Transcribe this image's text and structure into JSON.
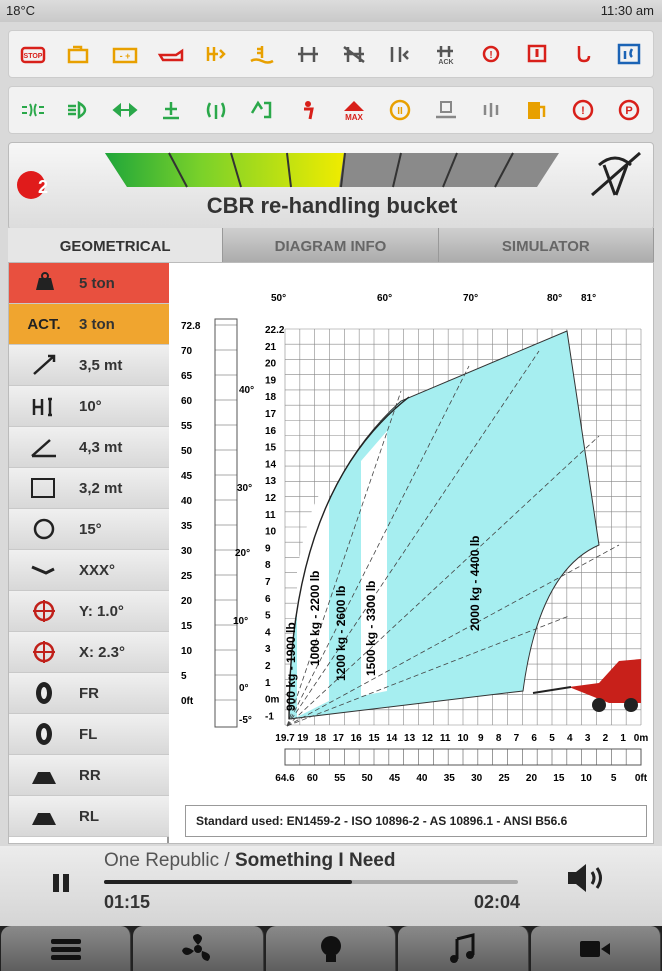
{
  "status": {
    "temperature": "18°C",
    "time": "11:30 am"
  },
  "warning_icons_row1": [
    "engine-stop",
    "engine-check",
    "battery",
    "oil-pressure",
    "transmission-warning",
    "coolant-temperature",
    "axle-lock",
    "axle-lock-off",
    "axle-alignment",
    "axle-ack",
    "brake-warning",
    "load-limit",
    "hook-warning",
    "hydraulic-oil-level"
  ],
  "warning_icons_row2": [
    "parking-lights",
    "headlights",
    "turn-indicators",
    "joystick-lock",
    "radio-remote",
    "boom-suspension",
    "operator-seat",
    "max-load",
    "gear-II",
    "steering-lock",
    "hand-brake",
    "fuel-level",
    "general-alarm",
    "parking-brake"
  ],
  "header": {
    "warning_badge": "2",
    "title": "CBR re-handling bucket",
    "load_gauge_level": 0.5
  },
  "tabs": [
    "GEOMETRICAL",
    "DIAGRAM INFO",
    "SIMULATOR"
  ],
  "side_rows": [
    {
      "icon": "weight-icon",
      "value": "5 ton",
      "bg": "#e8503f"
    },
    {
      "label": "ACT.",
      "value": "3 ton",
      "bg": "#f0a52f"
    },
    {
      "icon": "boom-length-icon",
      "value": "3,5 mt"
    },
    {
      "icon": "height-icon",
      "value": "10°"
    },
    {
      "icon": "angle-icon",
      "value": "4,3 mt"
    },
    {
      "icon": "reach-icon",
      "value": "3,2 mt"
    },
    {
      "icon": "rotation-icon",
      "value": "15°"
    },
    {
      "icon": "tilt-icon",
      "value": "XXX°"
    },
    {
      "icon": "level-y-icon",
      "value": "Y: 1.0°"
    },
    {
      "icon": "level-x-icon",
      "value": "X: 2.3°"
    },
    {
      "icon": "tire-icon",
      "value": "FR"
    },
    {
      "icon": "tire-icon",
      "value": "FL"
    },
    {
      "icon": "stabilizer-icon",
      "value": "RR"
    },
    {
      "icon": "stabilizer-icon",
      "value": "RL"
    }
  ],
  "chart": {
    "angle_labels_top": [
      "50°",
      "60°",
      "70°",
      "80°",
      "81°"
    ],
    "angle_labels_side": [
      "40°",
      "30°",
      "20°",
      "10°",
      "0°",
      "-5°"
    ],
    "ft_ticks": [
      "72.8",
      "70",
      "65",
      "60",
      "55",
      "50",
      "45",
      "40",
      "35",
      "30",
      "25",
      "20",
      "15",
      "10",
      "5",
      "0ft"
    ],
    "m_ticks": [
      "22.2",
      "21",
      "20",
      "19",
      "18",
      "17",
      "16",
      "15",
      "14",
      "13",
      "12",
      "11",
      "10",
      "9",
      "8",
      "7",
      "6",
      "5",
      "4",
      "3",
      "2",
      "1",
      "0m",
      "-1"
    ],
    "x_m_ticks": [
      "19.7",
      "19",
      "18",
      "17",
      "16",
      "15",
      "14",
      "13",
      "12",
      "11",
      "10",
      "9",
      "8",
      "7",
      "6",
      "5",
      "4",
      "3",
      "2",
      "1",
      "0m"
    ],
    "x_ft_ticks": [
      "64.6",
      "60",
      "55",
      "50",
      "45",
      "40",
      "35",
      "30",
      "25",
      "20",
      "15",
      "10",
      "5",
      "0ft"
    ],
    "zones": [
      "900 kg - 1900 lb",
      "1000 kg - 2200 lb",
      "1200 kg - 2600 lb",
      "1500 kg - 3300 lb",
      "2000 kg - 4400 lb"
    ]
  },
  "standard_text": "Standard used: EN1459-2 - ISO 10896-2 - AS 10896.1 - ANSI B56.6",
  "player": {
    "artist": "One Republic / ",
    "song": "Something I Need",
    "elapsed": "01:15",
    "total": "02:04",
    "progress": 0.6
  },
  "bottom_nav": [
    "menu-icon",
    "fan-icon",
    "light-icon",
    "music-icon",
    "camera-icon"
  ]
}
